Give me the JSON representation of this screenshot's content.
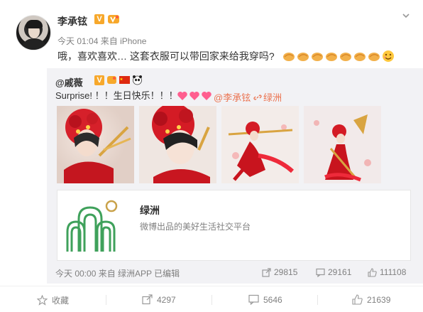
{
  "post": {
    "username": "李承铉",
    "v_badge": "V",
    "time": "今天 01:04",
    "source_prefix": "来自",
    "source": "iPhone",
    "text": "哦，喜欢喜欢… 这套衣服可以带回家来给我穿吗?"
  },
  "repost": {
    "username": "@戚薇",
    "v_badge": "V",
    "text": "Surprise! ！！生日快乐！！！",
    "mention": "@李承铉",
    "link_label": "绿洲",
    "card": {
      "title": "绿洲",
      "description": "微博出品的美好生活社交平台"
    },
    "meta": "今天 00:00 来自 绿洲APP  已编辑",
    "stats": {
      "reposts": "29815",
      "comments": "29161",
      "likes": "111108"
    }
  },
  "actions": {
    "favorite": "收藏",
    "reposts": "4297",
    "comments": "5646",
    "likes": "21639"
  },
  "colors": {
    "accent": "#eb7350",
    "muted": "#808080",
    "repost_bg": "#f2f2f5",
    "lvzhou_green": "#3fa15b",
    "lvzhou_gold": "#c9a24a"
  },
  "icons": {
    "caret": "chevron-down-icon",
    "repost": "share-icon",
    "comment": "comment-icon",
    "like": "thumbs-up-icon",
    "favorite": "star-icon"
  }
}
